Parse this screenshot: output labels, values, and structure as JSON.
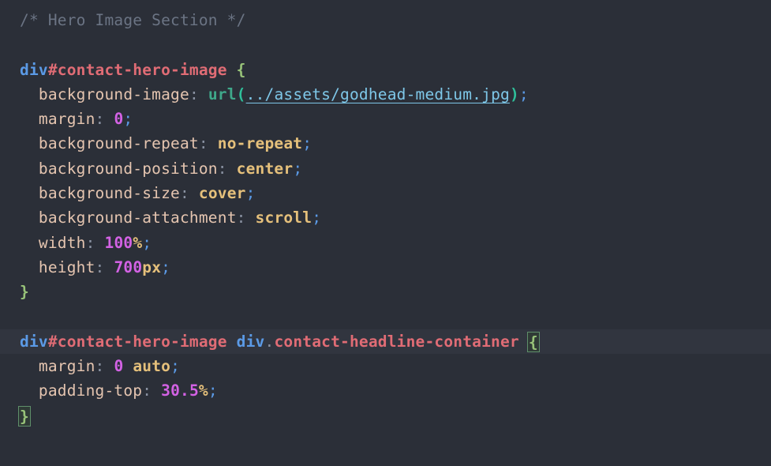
{
  "editor": {
    "name": "css-code-editor",
    "language": "CSS",
    "theme": {
      "background": "#2b2f38",
      "highlight_line_background": "#31353f",
      "comment": "#6b7484",
      "tag": "#5b9ae6",
      "selector": "#e06c75",
      "property": "#e5c5b0",
      "value": "#e5c07b",
      "number": "#d362e4",
      "unit": "#e5c07b",
      "semicolon": "#5b9ae6",
      "brace": "#98c379",
      "function": "#3fa88a",
      "paren": "#2fbf9a",
      "url_link": "#7ec7e8",
      "bracket_match_border": "#5f8f6a"
    }
  },
  "code": {
    "comment_line": "/* Hero Image Section */",
    "rule_one": {
      "selector_tag": "div",
      "selector_id": "#contact-hero-image",
      "open_brace": "{",
      "close_brace": "}",
      "declarations": [
        {
          "property": "background-image",
          "colon": ":",
          "function": "url",
          "open_paren": "(",
          "url": "../assets/godhead-medium.jpg",
          "close_paren": ")",
          "semicolon": ";"
        },
        {
          "property": "margin",
          "colon": ":",
          "number": "0",
          "semicolon": ";"
        },
        {
          "property": "background-repeat",
          "colon": ":",
          "value": "no-repeat",
          "semicolon": ";"
        },
        {
          "property": "background-position",
          "colon": ":",
          "value": "center",
          "semicolon": ";"
        },
        {
          "property": "background-size",
          "colon": ":",
          "value": "cover",
          "semicolon": ";"
        },
        {
          "property": "background-attachment",
          "colon": ":",
          "value": "scroll",
          "semicolon": ";"
        },
        {
          "property": "width",
          "colon": ":",
          "number": "100",
          "unit": "%",
          "semicolon": ";"
        },
        {
          "property": "height",
          "colon": ":",
          "number": "700",
          "unit": "px",
          "semicolon": ";"
        }
      ]
    },
    "rule_two": {
      "selector_tag_1": "div",
      "selector_id_1": "#contact-hero-image",
      "space": " ",
      "selector_tag_2": "div",
      "selector_dot": ".",
      "selector_class_2": "contact-headline-container",
      "open_brace": "{",
      "close_brace": "}",
      "declarations": [
        {
          "property": "margin",
          "colon": ":",
          "number": "0",
          "value": "auto",
          "semicolon": ";"
        },
        {
          "property": "padding-top",
          "colon": ":",
          "number": "30.5",
          "unit": "%",
          "semicolon": ";"
        }
      ]
    }
  }
}
